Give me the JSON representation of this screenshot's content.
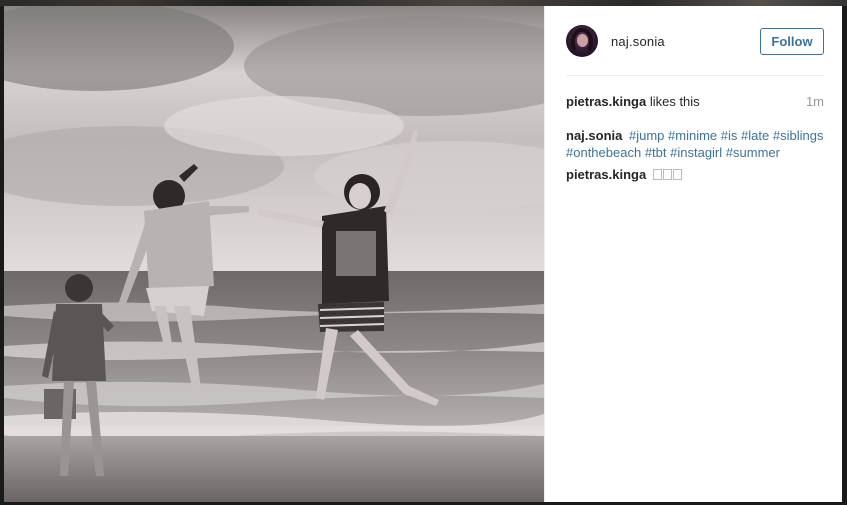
{
  "post": {
    "username": "naj.sonia",
    "follow_label": "Follow",
    "likes": {
      "liker": "pietras.kinga",
      "text": "likes this",
      "timestamp": "1m"
    },
    "caption": {
      "author": "naj.sonia",
      "hashtags": [
        "#jump",
        "#minime",
        "#is",
        "#late",
        "#siblings",
        "#onthebeach",
        "#tbt",
        "#instagirl",
        "#summer"
      ]
    },
    "comments": [
      {
        "author": "pietras.kinga",
        "emoji_count": 3
      }
    ]
  },
  "icons": {
    "avatar": "profile-avatar",
    "emoji": "missing-emoji-glyph"
  },
  "colors": {
    "link": "#3f729b",
    "text": "#262626",
    "muted": "#999999"
  }
}
